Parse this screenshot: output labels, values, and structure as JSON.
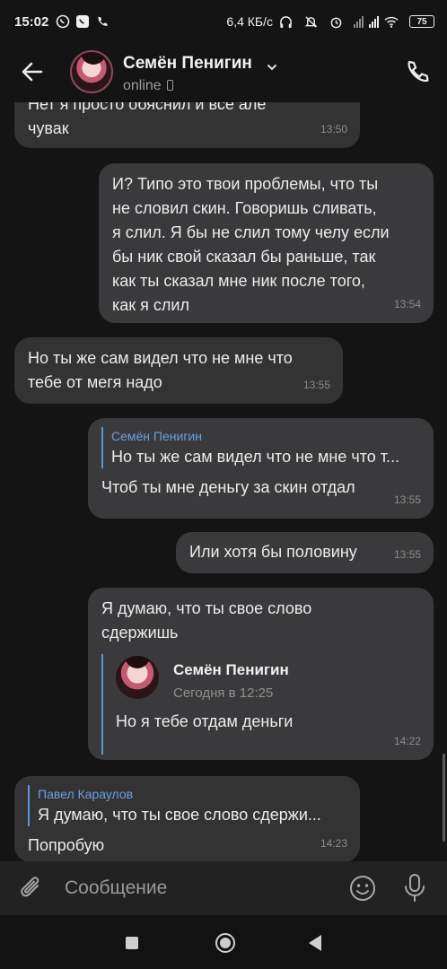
{
  "status_bar": {
    "time": "15:02",
    "speed": "6,4 КБ/с",
    "battery": "75"
  },
  "header": {
    "name": "Семён Пенигин",
    "status": "online"
  },
  "messages": [
    {
      "lines": [
        "Нет я просто обяснил и все але",
        "чувак"
      ],
      "time": "13:50"
    },
    {
      "lines": [
        "И? Типо это твои проблемы, что ты",
        "не словил скин. Говоришь сливать,",
        "я слил. Я бы не слил тому челу если",
        "бы ник свой сказал бы раньше, так",
        "как ты сказал мне ник после того,",
        "как я слил"
      ],
      "time": "13:54"
    },
    {
      "lines": [
        "Но ты же сам видел что не мне что",
        "тебе от мегя надо"
      ],
      "time": "13:55"
    },
    {
      "reply_name": "Семён Пенигин",
      "reply_text": "Но ты же сам видел что не мне что т...",
      "text": "Чтоб ты мне деньгу за скин отдал",
      "time": "13:55"
    },
    {
      "text": "Или хотя бы половину",
      "time": "13:55"
    },
    {
      "lines": [
        "Я думаю, что ты свое слово",
        "сдержишь"
      ],
      "fwd_name": "Семён Пенигин",
      "fwd_date": "Сегодня в 12:25",
      "fwd_text": "Но я тебе отдам деньги",
      "time": "14:22"
    },
    {
      "reply_name": "Павел Караулов",
      "reply_text": "Я думаю, что ты свое слово сдержи...",
      "text": "Попробую",
      "time": "14:23"
    }
  ],
  "composer": {
    "placeholder": "Сообщение"
  },
  "icons": {
    "back": "arrow-left-icon",
    "call": "phone-icon",
    "attach": "paperclip-icon",
    "emoji": "smile-icon",
    "voice": "microphone-icon"
  },
  "colors": {
    "background": "#141414",
    "bubble": "#333333",
    "reply_accent": "#5b91d9"
  }
}
